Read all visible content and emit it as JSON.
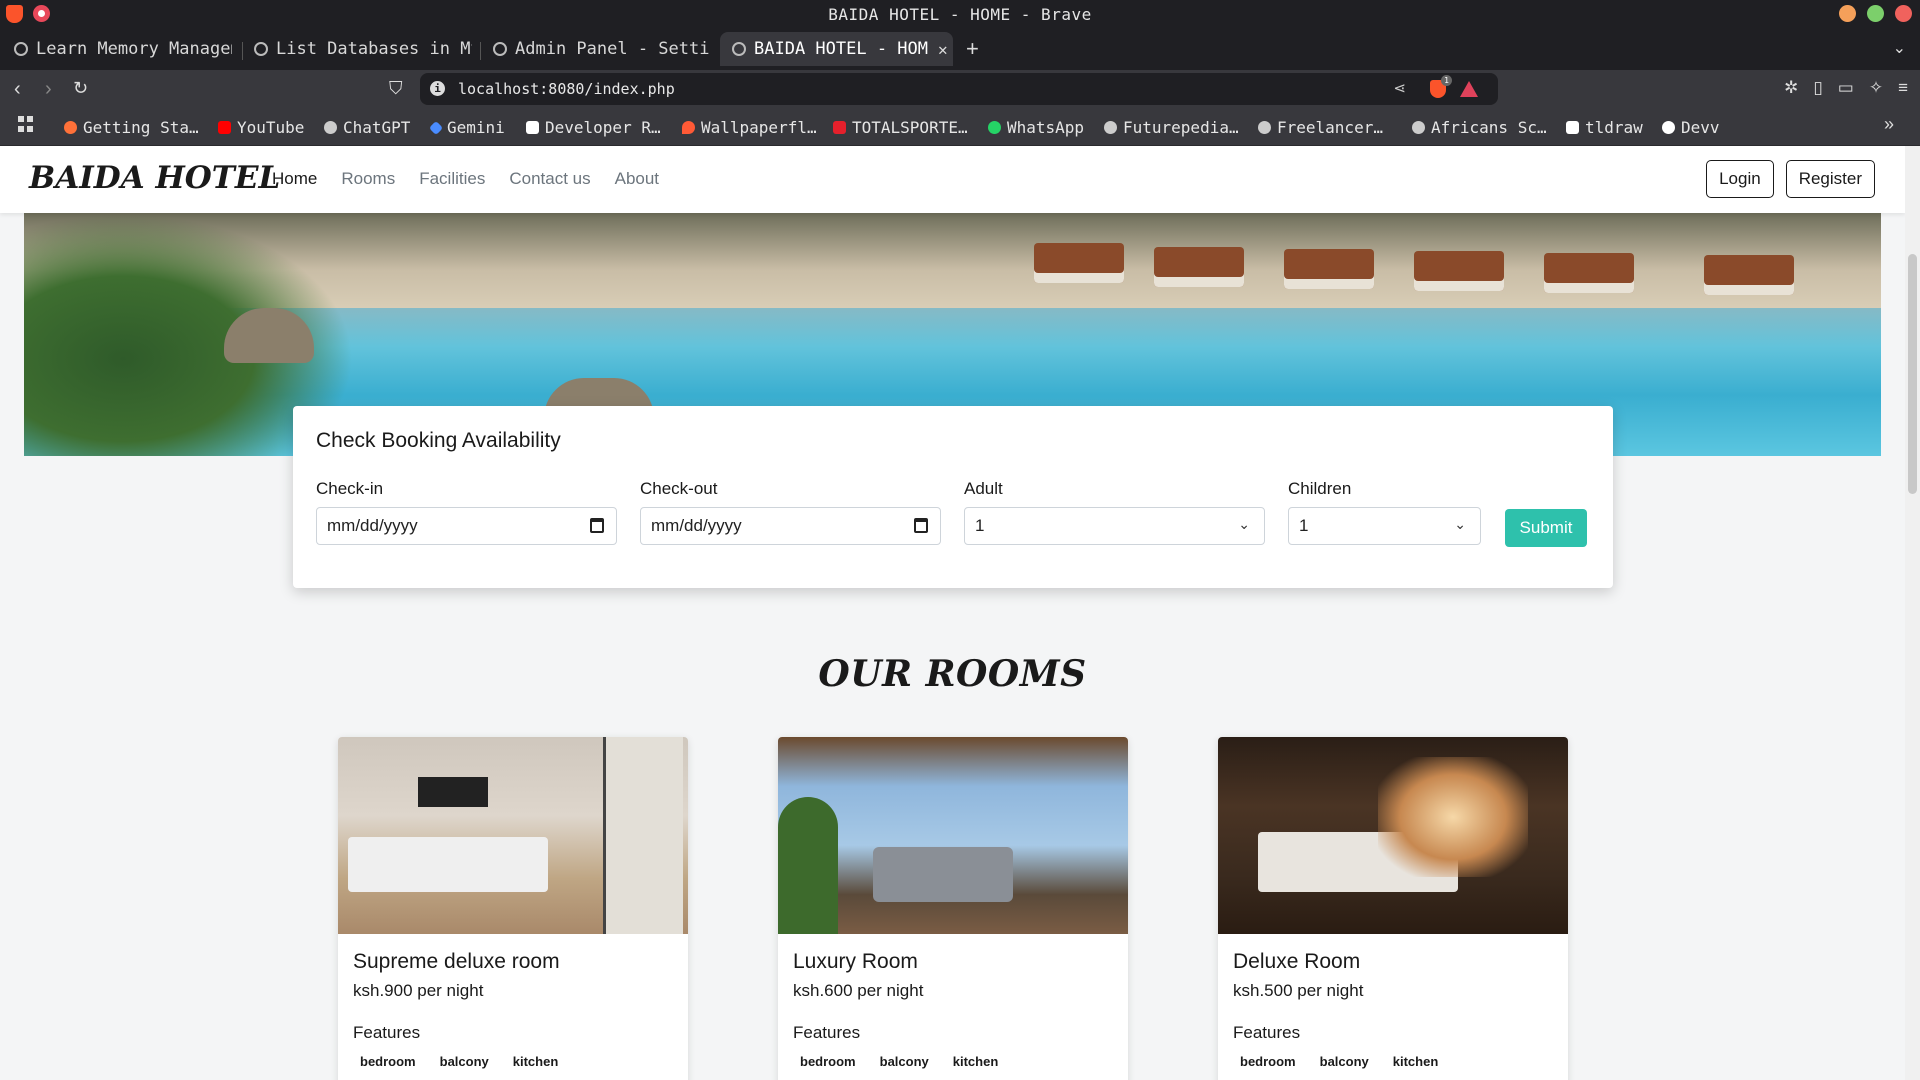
{
  "window": {
    "title": "BAIDA HOTEL - HOME - Brave"
  },
  "tabs": [
    {
      "label": "Learn Memory Managem",
      "active": false
    },
    {
      "label": "List Databases in My",
      "active": false
    },
    {
      "label": "Admin Panel - Settin",
      "active": false
    },
    {
      "label": "BAIDA HOTEL - HOM",
      "active": true
    }
  ],
  "address_bar": {
    "url": "localhost:8080/index.php",
    "shield_count": "1"
  },
  "bookmarks": [
    {
      "label": "Getting Sta…",
      "color": "#ff7139"
    },
    {
      "label": "YouTube",
      "color": "#ff0000"
    },
    {
      "label": "ChatGPT",
      "color": "#cccccc"
    },
    {
      "label": "Gemini",
      "color": "#4a8cff"
    },
    {
      "label": "Developer R…",
      "color": "#ffffff"
    },
    {
      "label": "Wallpaperfl…",
      "color": "#ff5a36"
    },
    {
      "label": "TOTALSPORTE…",
      "color": "#e5202c"
    },
    {
      "label": "WhatsApp",
      "color": "#25d366"
    },
    {
      "label": "Futurepedia…",
      "color": "#cccccc"
    },
    {
      "label": "Freelancer…",
      "color": "#cccccc"
    },
    {
      "label": "Africans Sc…",
      "color": "#cccccc"
    },
    {
      "label": "tldraw",
      "color": "#ffffff"
    },
    {
      "label": "Devv",
      "color": "#ffffff"
    }
  ],
  "site": {
    "brand": "BAIDA HOTEL",
    "nav": [
      "Home",
      "Rooms",
      "Facilities",
      "Contact us",
      "About"
    ],
    "login_label": "Login",
    "register_label": "Register"
  },
  "booking": {
    "title": "Check Booking Availability",
    "checkin_label": "Check-in",
    "checkin_placeholder": "mm/dd/yyyy",
    "checkout_label": "Check-out",
    "checkout_placeholder": "mm/dd/yyyy",
    "adult_label": "Adult",
    "adult_value": "1",
    "children_label": "Children",
    "children_value": "1",
    "submit_label": "Submit",
    "accent": "#2ec1ac"
  },
  "rooms_section": {
    "title": "OUR ROOMS"
  },
  "rooms": [
    {
      "name": "Supreme deluxe room",
      "price": "ksh.900 per night",
      "features_label": "Features",
      "features": [
        "bedroom",
        "balcony",
        "kitchen"
      ]
    },
    {
      "name": "Luxury Room",
      "price": "ksh.600 per night",
      "features_label": "Features",
      "features": [
        "bedroom",
        "balcony",
        "kitchen"
      ]
    },
    {
      "name": "Deluxe Room",
      "price": "ksh.500 per night",
      "features_label": "Features",
      "features": [
        "bedroom",
        "balcony",
        "kitchen"
      ]
    }
  ]
}
